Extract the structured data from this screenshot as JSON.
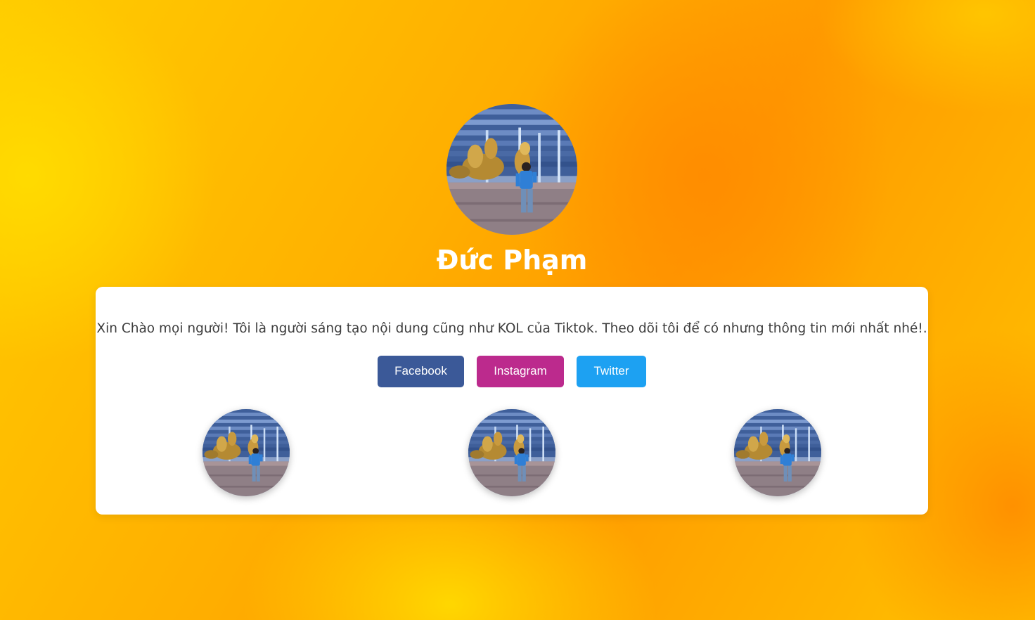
{
  "profile": {
    "name": "Đức Phạm",
    "avatar_icon": "profile-photo"
  },
  "card": {
    "bio": "Xin Chào mọi người! Tôi là người sáng tạo nội dung cũng như KOL của Tiktok. Theo dõi tôi để có nhưng thông tin mới nhất nhé!.",
    "buttons": [
      {
        "label": "Facebook",
        "color": "#3b5998"
      },
      {
        "label": "Instagram",
        "color": "#bc2a8d"
      },
      {
        "label": "Twitter",
        "color": "#1da1f2"
      }
    ],
    "gallery_icon": "profile-photo"
  },
  "colors": {
    "background_primary": "#ffb300",
    "background_accent": "#ff8c00",
    "card_background": "#ffffff",
    "text_color": "#3d3d3d"
  }
}
